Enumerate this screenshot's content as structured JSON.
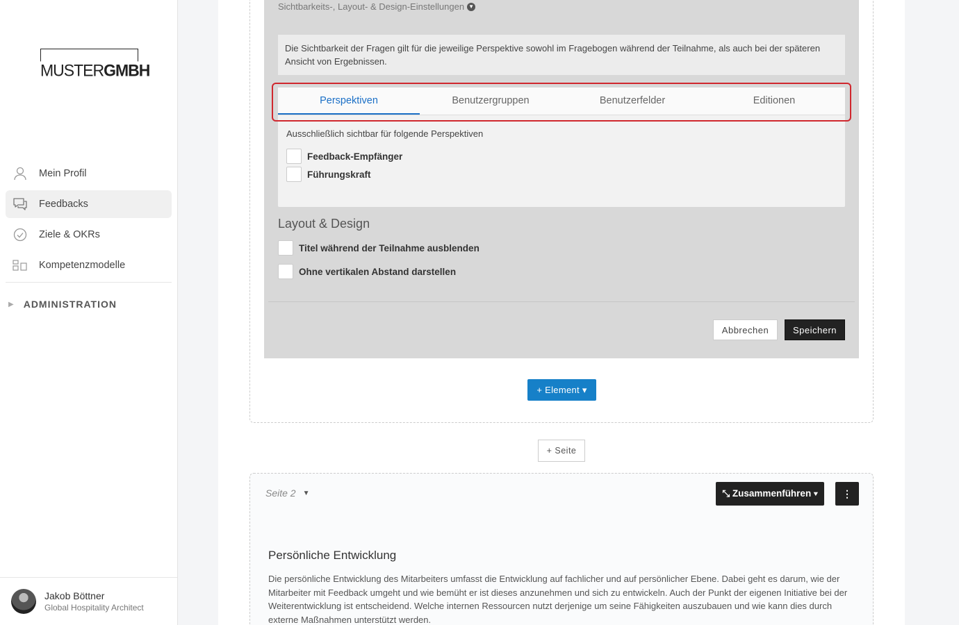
{
  "brand": {
    "logo_light": "MUSTER",
    "logo_bold": "GMBH"
  },
  "sidebar": {
    "items": [
      {
        "label": "Mein Profil",
        "icon": "user-icon"
      },
      {
        "label": "Feedbacks",
        "icon": "chat-icon"
      },
      {
        "label": "Ziele & OKRs",
        "icon": "check-circle-icon"
      },
      {
        "label": "Kompetenzmodelle",
        "icon": "blocks-icon"
      }
    ],
    "admin_label": "ADMINISTRATION"
  },
  "user": {
    "name": "Jakob Böttner",
    "role": "Global Hospitality Architect"
  },
  "editor": {
    "settings_toggle": "Sichtbarkeits-, Layout- & Design-Einstellungen",
    "info": "Die Sichtbarkeit der Fragen gilt für die jeweilige Perspektive sowohl im Fragebogen während der Teilnahme, als auch bei der späteren Ansicht von Ergebnissen.",
    "tabs": [
      "Perspektiven",
      "Benutzergruppen",
      "Benutzerfelder",
      "Editionen"
    ],
    "active_tab": "Perspektiven",
    "perspectives_hint": "Ausschließlich sichtbar für folgende Perspektiven",
    "perspectives": [
      {
        "label": "Feedback-Empfänger",
        "checked": false
      },
      {
        "label": "Führungskraft",
        "checked": false
      }
    ],
    "layout_title": "Layout & Design",
    "layout_options": [
      {
        "label": "Titel während der Teilnahme ausblenden",
        "checked": false
      },
      {
        "label": "Ohne vertikalen Abstand darstellen",
        "checked": false
      }
    ],
    "cancel_label": "Abbrechen",
    "save_label": "Speichern"
  },
  "add_element_label": "+ Element",
  "add_page_label": "+ Seite",
  "page2": {
    "label": "Seite 2",
    "merge_label": "Zusammenführen",
    "title": "Persönliche Entwicklung",
    "text": "Die persönliche Entwicklung des Mitarbeiters umfasst die Entwicklung auf fachlicher und auf persönlicher Ebene. Dabei geht es darum, wie der Mitarbeiter mit Feedback umgeht und wie bemüht er ist dieses anzunehmen und sich zu entwickeln. Auch der Punkt der eigenen Initiative bei der Weiterentwicklung ist entscheidend. Welche internen Ressourcen nutzt derjenige um seine Fähigkeiten auszubauen und wie kann dies durch externe Maßnahmen unterstützt werden."
  },
  "colors": {
    "accent": "#1a6fc6",
    "highlight": "#d0272e",
    "primary_button": "#1680c8"
  }
}
